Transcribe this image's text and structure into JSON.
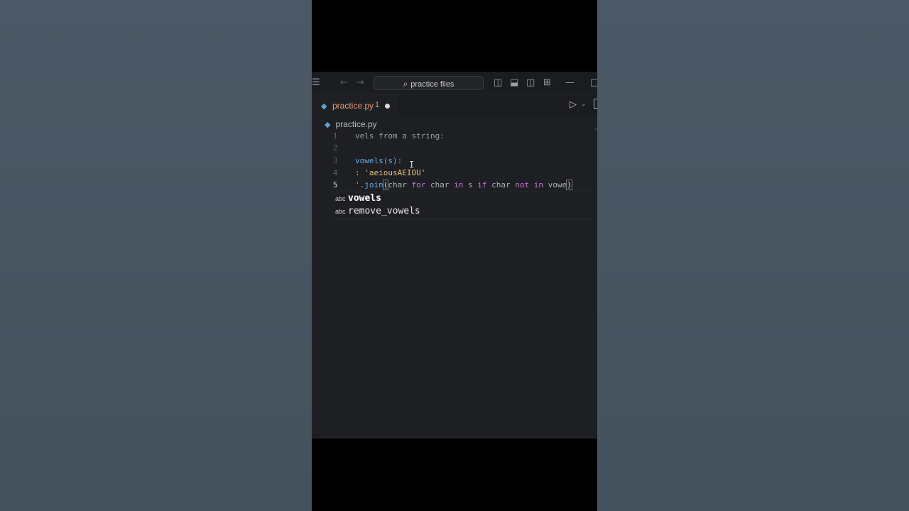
{
  "titlebar": {
    "search_placeholder": "practice files",
    "menu_icon": "hamburger-icon",
    "back_icon": "arrow-left-icon",
    "forward_icon": "arrow-right-icon"
  },
  "tab": {
    "label": "practice.py",
    "badge": "1",
    "dirty": true
  },
  "breadcrumb": {
    "file": "practice.py"
  },
  "editor": {
    "active_line": 5,
    "lines": [
      {
        "n": "1",
        "text": "vels from a string:"
      },
      {
        "n": "2",
        "text": ""
      },
      {
        "n": "3",
        "text": "vowels(s):"
      },
      {
        "n": "4",
        "text": ": 'aeiousAEIOU'"
      },
      {
        "n": "5",
        "text": "'.join(char for char in s if char not in vowe)"
      }
    ]
  },
  "suggestions": [
    {
      "kind": "abc",
      "label": "vowels"
    },
    {
      "kind": "abc",
      "label": "remove_vowels"
    }
  ],
  "colors": {
    "tab_modified": "#e39a72",
    "keyword": "#c678dd",
    "function": "#61afef",
    "string": "#e5c07b"
  }
}
